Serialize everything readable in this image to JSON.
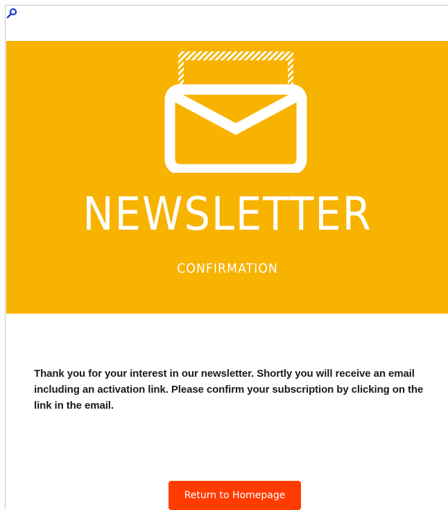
{
  "toolbar": {
    "zoom_icon": "magnifier-icon"
  },
  "banner": {
    "background_color": "#F8B200",
    "icon": "envelope-icon",
    "title": "NEWSLETTER",
    "subtitle": "CONFIRMATION"
  },
  "main": {
    "message": "Thank you for your interest in our newsletter. Shortly you will receive an email including an activation link. Please confirm your subscription by clicking on the link in the email."
  },
  "cta": {
    "label": "Return to Homepage",
    "color": "#FF3B00"
  }
}
